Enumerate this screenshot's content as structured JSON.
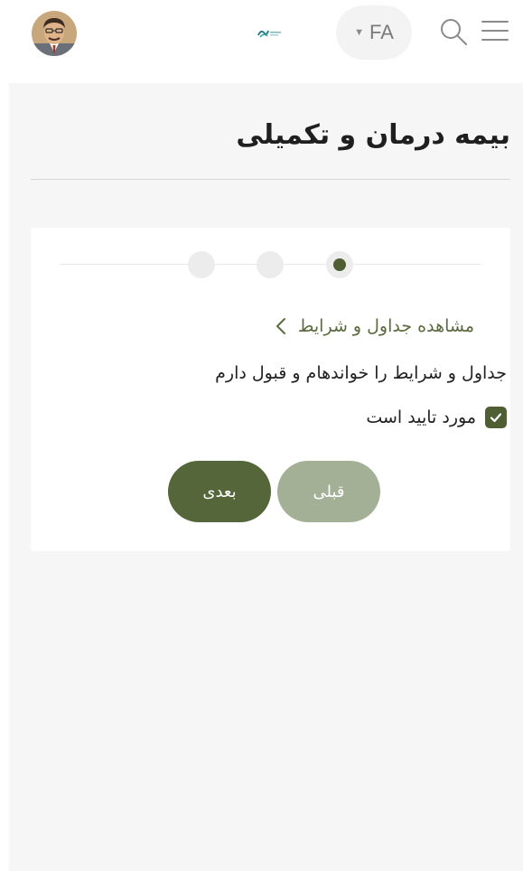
{
  "header": {
    "language": "FA",
    "icons": {
      "avatar": "avatar",
      "logo": "brand-logo",
      "language_caret": "caret-down-icon",
      "search": "search-icon",
      "menu": "hamburger-menu-icon"
    }
  },
  "page": {
    "title": "بیمه درمان و تکمیلی"
  },
  "wizard": {
    "steps_total": 3,
    "active_step": 1,
    "view_terms_link": "مشاهده جداول و شرایط",
    "terms_statement": "جداول و شرایط را خواندهام و قبول دارم",
    "confirm_label": "مورد تایید است",
    "confirm_checked": true,
    "prev_button": "قبلی",
    "next_button": "بعدی"
  },
  "colors": {
    "primary": "#55663a",
    "primary_light": "#a4b095",
    "link": "#5b6b40",
    "background": "#f6f6f6",
    "card": "#ffffff"
  }
}
